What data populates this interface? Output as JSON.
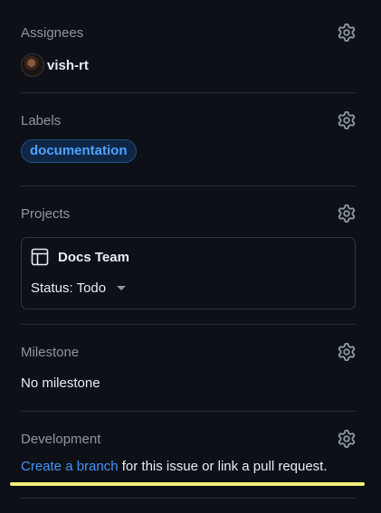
{
  "assignees": {
    "title": "Assignees",
    "gear_icon": "gear-icon",
    "user": "vish-rt"
  },
  "labels": {
    "title": "Labels",
    "gear_icon": "gear-icon",
    "items": [
      "documentation"
    ],
    "label_color": "#4ea1ff"
  },
  "projects": {
    "title": "Projects",
    "gear_icon": "gear-icon",
    "project_icon": "table-icon",
    "name": "Docs Team",
    "status": "Status: Todo"
  },
  "milestone": {
    "title": "Milestone",
    "gear_icon": "gear-icon",
    "value": "No milestone"
  },
  "development": {
    "title": "Development",
    "gear_icon": "gear-icon",
    "link_text": "Create a branch",
    "rest_text": " for this issue or link a pull request.",
    "link_color": "#4493f8",
    "highlight_color": "#f4ef7a"
  }
}
